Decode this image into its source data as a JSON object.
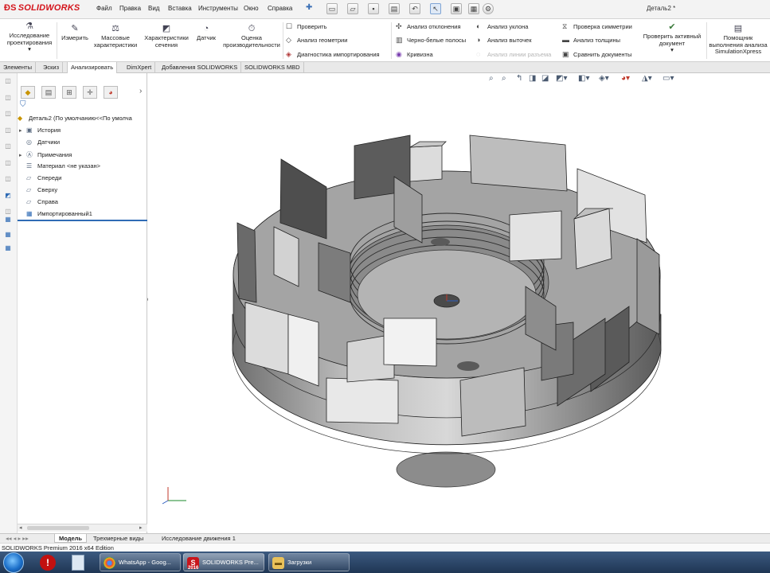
{
  "app": {
    "brand": "SOLIDWORKS",
    "document_title": "Деталь2 *"
  },
  "menu": [
    "Файл",
    "Правка",
    "Вид",
    "Вставка",
    "Инструменты",
    "Окно",
    "Справка"
  ],
  "ribbon": {
    "big": [
      {
        "label": "Исследование проектирования",
        "icon": "design-study-icon"
      },
      {
        "label": "Измерить",
        "icon": "measure-icon"
      },
      {
        "label": "Массовые характеристики",
        "icon": "mass-properties-icon"
      },
      {
        "label": "Характеристики сечения",
        "icon": "section-properties-icon"
      },
      {
        "label": "Датчик",
        "icon": "sensor-icon"
      },
      {
        "label": "Оценка производительности",
        "icon": "performance-icon"
      }
    ],
    "col1": [
      "Проверить",
      "Анализ геометрии",
      "Диагностика импортирования"
    ],
    "col2": [
      "Анализ отклонения",
      "Черно-белые полосы",
      "Кривизна"
    ],
    "col3": [
      "Анализ уклона",
      "Анализ выточек",
      "Анализ линии разъема"
    ],
    "col4": [
      "Проверка симметрии",
      "Анализ толщины",
      "Сравнить документы"
    ],
    "check_active": "Проверить активный документ",
    "simxpress": "Помощник выполнения анализа SimulationXpress"
  },
  "tabs": [
    "Элементы",
    "Эскиз",
    "Анализировать",
    "DimXpert",
    "Добавления SOLIDWORKS",
    "SOLIDWORKS MBD"
  ],
  "active_tab": "Анализировать",
  "tree": {
    "root": "Деталь2  (По умолчанию<<По умолча",
    "items": [
      "История",
      "Датчики",
      "Примечания",
      "Материал <не указан>",
      "Спереди",
      "Сверху",
      "Справа",
      "Импортированный1"
    ]
  },
  "bottom_tabs": [
    "Модель",
    "Трехмерные виды",
    "Исследование движения 1"
  ],
  "status": "SOLIDWORKS Premium 2016 x64 Edition",
  "taskbar": [
    {
      "label": "WhatsApp - Goog...",
      "icon": "chrome-icon"
    },
    {
      "label": "SOLIDWORKS Pre...",
      "icon": "solidworks-icon",
      "badge": "2016"
    },
    {
      "label": "Загрузки",
      "icon": "folder-icon"
    }
  ],
  "colors": {
    "brand_red": "#d4141b",
    "taskbar": "#2a4466",
    "part_gray": "#a9a9a9"
  }
}
